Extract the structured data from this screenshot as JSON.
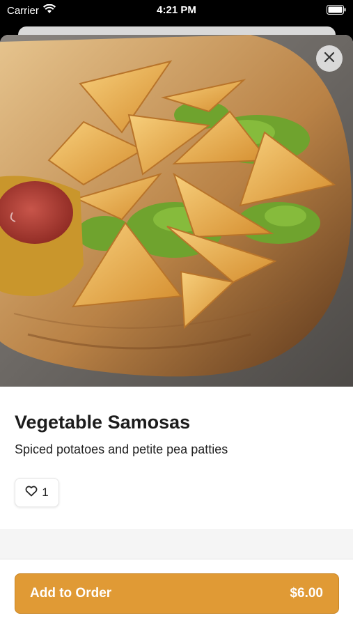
{
  "status_bar": {
    "carrier": "Carrier",
    "time": "4:21 PM"
  },
  "product": {
    "name": "Vegetable Samosas",
    "description": "Spiced potatoes and petite pea patties",
    "likes": "1"
  },
  "order_button": {
    "label": "Add to Order",
    "price": "$6.00"
  },
  "colors": {
    "accent": "#e09a35",
    "accent_border": "#c98523"
  },
  "icons": [
    "wifi-icon",
    "battery-icon",
    "close-icon",
    "heart-icon"
  ]
}
